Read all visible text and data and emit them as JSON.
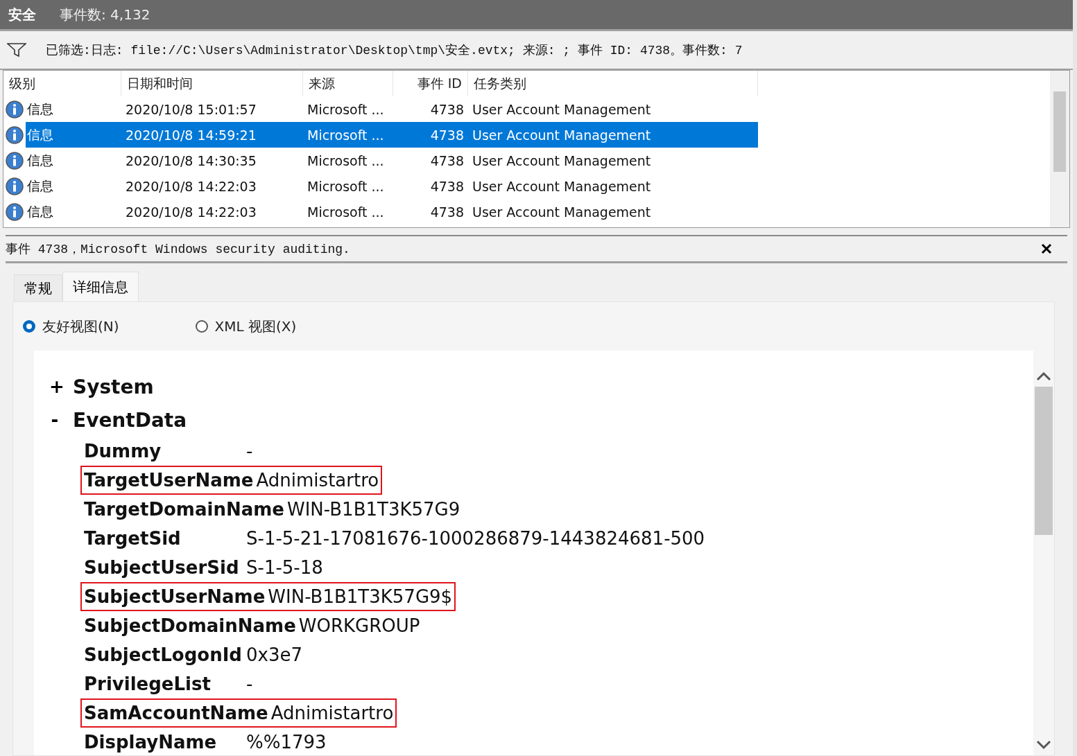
{
  "header": {
    "title": "安全",
    "count": "事件数: 4,132"
  },
  "filter": {
    "text": "已筛选:日志: file://C:\\Users\\Administrator\\Desktop\\tmp\\安全.evtx; 来源: ; 事件 ID: 4738。事件数: 7"
  },
  "table": {
    "columns": [
      "级别",
      "日期和时间",
      "来源",
      "事件 ID",
      "任务类别"
    ],
    "rows": [
      {
        "level": "信息",
        "date": "2020/10/8 15:01:57",
        "source": "Microsoft ...",
        "event_id": "4738",
        "task": "User Account Management",
        "selected": false
      },
      {
        "level": "信息",
        "date": "2020/10/8 14:59:21",
        "source": "Microsoft ...",
        "event_id": "4738",
        "task": "User Account Management",
        "selected": true
      },
      {
        "level": "信息",
        "date": "2020/10/8 14:30:35",
        "source": "Microsoft ...",
        "event_id": "4738",
        "task": "User Account Management",
        "selected": false
      },
      {
        "level": "信息",
        "date": "2020/10/8 14:22:03",
        "source": "Microsoft ...",
        "event_id": "4738",
        "task": "User Account Management",
        "selected": false
      },
      {
        "level": "信息",
        "date": "2020/10/8 14:22:03",
        "source": "Microsoft ...",
        "event_id": "4738",
        "task": "User Account Management",
        "selected": false
      }
    ]
  },
  "detail": {
    "title": "事件 4738，Microsoft Windows security auditing.",
    "tabs": [
      {
        "label": "常规",
        "selected": false
      },
      {
        "label": "详细信息",
        "selected": true
      }
    ],
    "views": [
      {
        "label": "友好视图(N)",
        "selected": true
      },
      {
        "label": "XML 视图(X)",
        "selected": false
      }
    ],
    "tree": [
      {
        "sign": "+",
        "label": "System"
      },
      {
        "sign": "-",
        "label": "EventData",
        "fields": [
          {
            "key": "Dummy",
            "value": "-",
            "highlighted": false
          },
          {
            "key": "TargetUserName",
            "value": "Adnimistartro",
            "highlighted": true
          },
          {
            "key": "TargetDomainName",
            "value": "WIN-B1B1T3K57G9",
            "highlighted": false
          },
          {
            "key": "TargetSid",
            "value": "S-1-5-21-17081676-1000286879-1443824681-500",
            "highlighted": false
          },
          {
            "key": "SubjectUserSid",
            "value": "S-1-5-18",
            "highlighted": false
          },
          {
            "key": "SubjectUserName",
            "value": "WIN-B1B1T3K57G9$",
            "highlighted": true
          },
          {
            "key": "SubjectDomainName",
            "value": "WORKGROUP",
            "highlighted": false
          },
          {
            "key": "SubjectLogonId",
            "value": "0x3e7",
            "highlighted": false
          },
          {
            "key": "PrivilegeList",
            "value": "-",
            "highlighted": false
          },
          {
            "key": "SamAccountName",
            "value": "Adnimistartro",
            "highlighted": true
          },
          {
            "key": "DisplayName",
            "value": "%%1793",
            "highlighted": false
          }
        ]
      }
    ]
  }
}
